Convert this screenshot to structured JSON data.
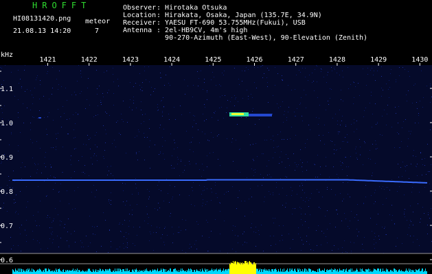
{
  "app": {
    "title": "HROFFT",
    "filename": "HI08131420.png",
    "datetime": "21.08.13 14:20",
    "meteor_label": "meteor",
    "meteor_count": "7"
  },
  "info": {
    "labels": [
      "Observer",
      "Location",
      "Receiver",
      "Antenna",
      ""
    ],
    "values": [
      "Hirotaka Otsuka",
      "Hirakata, Osaka, Japan (135.7E, 34.9N)",
      "YAESU FT-690 53.755MHz(Fukui), USB",
      "2el-HB9CV, 4m's high",
      "90-270-Azimuth (East-West), 90-Elevation (Zenith)"
    ]
  },
  "axes": {
    "y_unit": "kHz",
    "x_ticks": [
      "1421",
      "1422",
      "1423",
      "1424",
      "1425",
      "1426",
      "1427",
      "1428",
      "1429",
      "1430"
    ],
    "y_ticks": [
      "1.1",
      "1.0",
      "0.9",
      "0.8",
      "0.7",
      "0.6"
    ]
  },
  "colors": {
    "background": "#000000",
    "noise": "#0a1a6a",
    "carrier": "#3a6cff",
    "echo_hot": "#f0ff30",
    "echo_warm": "#30e0a0",
    "level_bar": "#00d8ff",
    "level_peak": "#ffff00",
    "title_green": "#2fdc2f"
  }
}
